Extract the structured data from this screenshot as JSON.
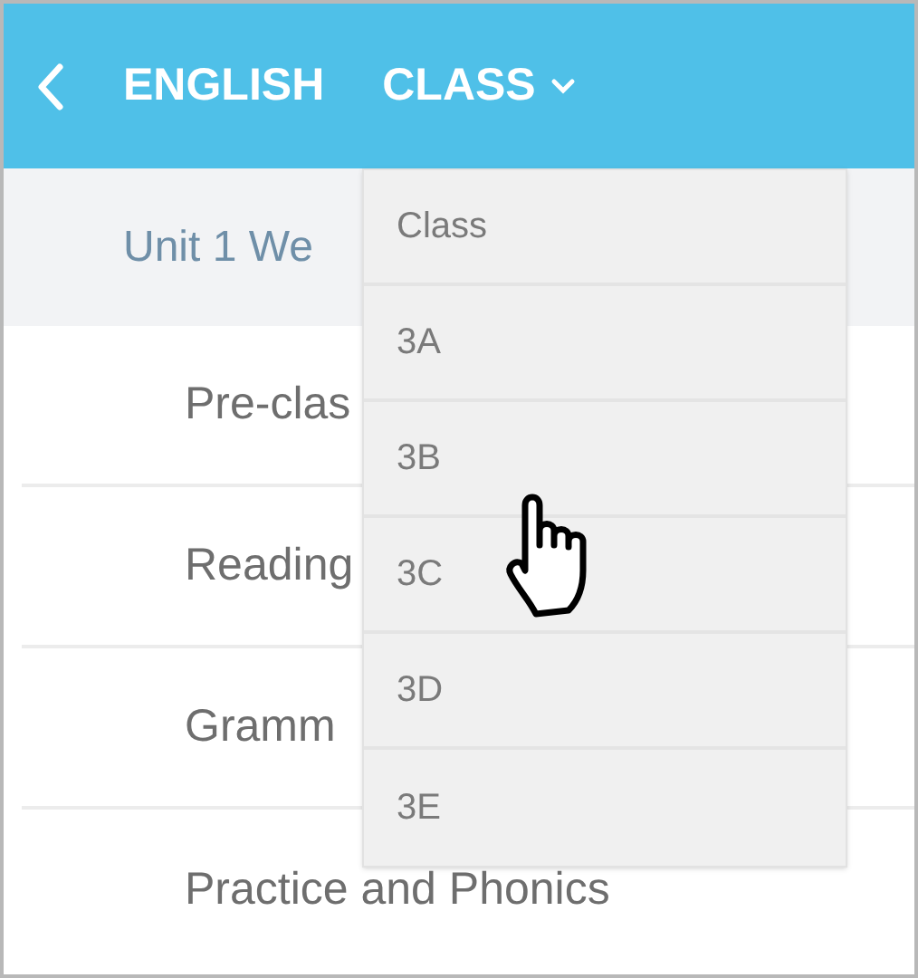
{
  "header": {
    "title": "ENGLISH",
    "class_menu": "CLASS"
  },
  "unit": {
    "title": "Unit 1 We"
  },
  "lessons": [
    "Pre-clas",
    "Reading",
    "Gramm",
    "Practice and Phonics"
  ],
  "dropdown": {
    "items": [
      "Class",
      "3A",
      "3B",
      "3C",
      "3D",
      "3E"
    ]
  }
}
